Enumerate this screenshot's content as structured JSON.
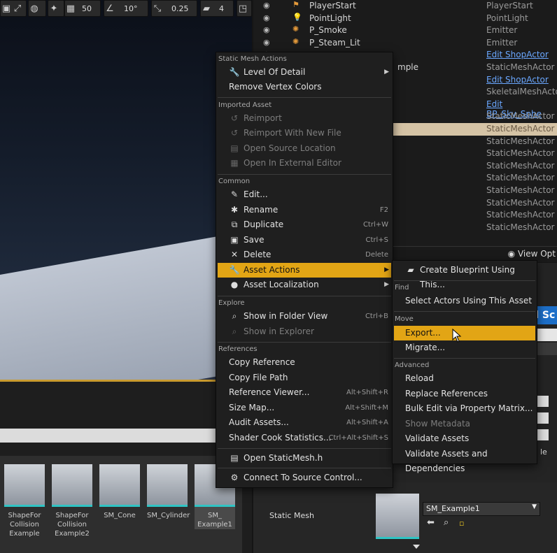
{
  "toolbar": {
    "grid_snap": "50",
    "rot_snap": "10°",
    "scale_snap": "0.25",
    "cam_speed": "4"
  },
  "outliner": {
    "rows": [
      {
        "name": "PlayerStart",
        "type": "PlayerStart",
        "link": false,
        "icon": "flag-icon",
        "sel": false
      },
      {
        "name": "PointLight",
        "type": "PointLight",
        "link": false,
        "icon": "lightbulb-icon",
        "sel": false
      },
      {
        "name": "P_Smoke",
        "type": "Emitter",
        "link": false,
        "icon": "emitter-icon",
        "sel": false
      },
      {
        "name": "P_Steam_Lit",
        "type": "Emitter",
        "link": false,
        "icon": "emitter-icon",
        "sel": false
      },
      {
        "name": "",
        "type": "Edit ShopActor",
        "link": true,
        "icon": "",
        "sel": false
      },
      {
        "name": "mple",
        "type": "StaticMeshActor",
        "link": false,
        "icon": "",
        "sel": false
      },
      {
        "name": "",
        "type": "Edit ShopActor",
        "link": true,
        "icon": "",
        "sel": false
      },
      {
        "name": "",
        "type": "SkeletalMeshActor",
        "link": false,
        "icon": "",
        "sel": false
      },
      {
        "name": "",
        "type": "Edit BP_Sky_Sphe",
        "link": true,
        "icon": "",
        "sel": false
      },
      {
        "name": "",
        "type": "StaticMeshActor",
        "link": false,
        "icon": "",
        "sel": false
      },
      {
        "name": "",
        "type": "StaticMeshActor",
        "link": false,
        "icon": "",
        "sel": true
      },
      {
        "name": "",
        "type": "StaticMeshActor",
        "link": false,
        "icon": "",
        "sel": false
      },
      {
        "name": "",
        "type": "StaticMeshActor",
        "link": false,
        "icon": "",
        "sel": false
      },
      {
        "name": "",
        "type": "StaticMeshActor",
        "link": false,
        "icon": "",
        "sel": false
      },
      {
        "name": "",
        "type": "StaticMeshActor",
        "link": false,
        "icon": "",
        "sel": false
      },
      {
        "name": "",
        "type": "StaticMeshActor",
        "link": false,
        "icon": "",
        "sel": false
      },
      {
        "name": "",
        "type": "StaticMeshActor",
        "link": false,
        "icon": "",
        "sel": false
      },
      {
        "name": "",
        "type": "StaticMeshActor",
        "link": false,
        "icon": "",
        "sel": false
      },
      {
        "name": "",
        "type": "StaticMeshActor",
        "link": false,
        "icon": "",
        "sel": false
      }
    ],
    "view_options": "View Opt"
  },
  "add_button": "d Sc",
  "side_label": "le",
  "content_browser": {
    "assets": [
      {
        "label": "ShapeFor Collision Example",
        "sel": false
      },
      {
        "label": "ShapeFor Collision Example2",
        "sel": false
      },
      {
        "label": "SM_Cone",
        "sel": false
      },
      {
        "label": "SM_Cylinder",
        "sel": false
      },
      {
        "label": "SM_ Example1",
        "sel": true
      }
    ]
  },
  "details": {
    "static_mesh_label": "Static Mesh",
    "static_mesh_value": "SM_Example1"
  },
  "context_menu": {
    "sections": {
      "static_mesh_actions": "Static Mesh Actions",
      "imported_asset": "Imported Asset",
      "common": "Common",
      "explore": "Explore",
      "references": "References"
    },
    "items": {
      "level_of_detail": "Level Of Detail",
      "remove_vertex_colors": "Remove Vertex Colors",
      "reimport": "Reimport",
      "reimport_new": "Reimport With New File",
      "open_source": "Open Source Location",
      "open_external": "Open In External Editor",
      "edit": "Edit...",
      "rename": "Rename",
      "rename_sc": "F2",
      "duplicate": "Duplicate",
      "duplicate_sc": "Ctrl+W",
      "save": "Save",
      "save_sc": "Ctrl+S",
      "delete": "Delete",
      "delete_sc": "Delete",
      "asset_actions": "Asset Actions",
      "asset_localization": "Asset Localization",
      "show_folder": "Show in Folder View",
      "show_folder_sc": "Ctrl+B",
      "show_explorer": "Show in Explorer",
      "copy_ref": "Copy Reference",
      "copy_path": "Copy File Path",
      "ref_viewer": "Reference Viewer...",
      "ref_viewer_sc": "Alt+Shift+R",
      "size_map": "Size Map...",
      "size_map_sc": "Alt+Shift+M",
      "audit": "Audit Assets...",
      "audit_sc": "Alt+Shift+A",
      "shader_cook": "Shader Cook Statistics...",
      "shader_cook_sc": "Ctrl+Alt+Shift+S",
      "open_static_mesh": "Open StaticMesh.h",
      "connect_sc": "Connect To Source Control..."
    }
  },
  "submenu": {
    "sections": {
      "find": "Find",
      "move": "Move",
      "advanced": "Advanced"
    },
    "items": {
      "create_blueprint": "Create Blueprint Using This...",
      "select_actors": "Select Actors Using This Asset",
      "export": "Export...",
      "migrate": "Migrate...",
      "reload": "Reload",
      "replace_refs": "Replace References",
      "bulk_edit": "Bulk Edit via Property Matrix...",
      "show_metadata": "Show Metadata",
      "validate": "Validate Assets",
      "validate_deps": "Validate Assets and Dependencies"
    }
  }
}
